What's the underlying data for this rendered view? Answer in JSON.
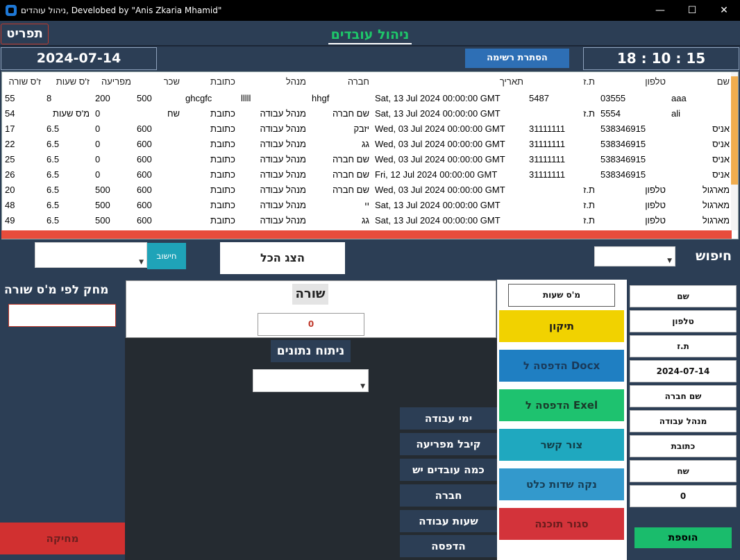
{
  "window": {
    "title": "ניהול עוהדים, Develobed by \"Anis Zkaria Mhamid\"",
    "minimize": "—",
    "maximize": "☐",
    "close": "✕"
  },
  "header": {
    "menu_label": "תפריט",
    "app_title": "ניהול עובדים",
    "date": "2024-07-14",
    "hide_list_label": "הסתרת רשימה",
    "time": "18 : 10 : 15"
  },
  "table": {
    "columns": [
      "ז'ס שורה",
      "ז'ס שעות",
      "מפריעה",
      "שכר",
      "כתובת",
      "מנהל",
      "חברה",
      "תאריך",
      "ת.ז",
      "טלפון",
      "שם"
    ],
    "rows": [
      [
        "55",
        "8",
        "200",
        "500",
        "ghcgfc",
        "lllll",
        "hhgf",
        "Sat, 13 Jul 2024 00:00:00 GMT",
        "5487",
        "03555",
        "aaa"
      ],
      [
        "54",
        "מ'ס שעות",
        "0",
        "שח",
        "כתובת",
        "מנהל עבודה",
        "שם חברה",
        "Sat, 13 Jul 2024 00:00:00 GMT",
        "ת.ז",
        "5554",
        "ali"
      ],
      [
        "17",
        "6.5",
        "0",
        "600",
        "כתובת",
        "מנהל עבודה",
        "יזבק",
        "Wed, 03 Jul 2024 00:00:00 GMT",
        "31111111",
        "538346915",
        "אניס"
      ],
      [
        "22",
        "6.5",
        "0",
        "600",
        "כתובת",
        "מנהל עבודה",
        "גג",
        "Wed, 03 Jul 2024 00:00:00 GMT",
        "31111111",
        "538346915",
        "אניס"
      ],
      [
        "25",
        "6.5",
        "0",
        "600",
        "כתובת",
        "מנהל עבודה",
        "שם חברה",
        "Wed, 03 Jul 2024 00:00:00 GMT",
        "31111111",
        "538346915",
        "אניס"
      ],
      [
        "26",
        "6.5",
        "0",
        "600",
        "כתובת",
        "מנהל עבודה",
        "שם חברה",
        "Fri, 12 Jul 2024 00:00:00 GMT",
        "31111111",
        "538346915",
        "אניס"
      ],
      [
        "20",
        "6.5",
        "500",
        "600",
        "כתובת",
        "מנהל עבודה",
        "שם חברה",
        "Wed, 03 Jul 2024 00:00:00 GMT",
        "ת.ז",
        "טלפון",
        "מארגול"
      ],
      [
        "48",
        "6.5",
        "500",
        "600",
        "כתובת",
        "מנהל עבודה",
        "יי",
        "Sat, 13 Jul 2024 00:00:00 GMT",
        "ת.ז",
        "טלפון",
        "מארגול"
      ],
      [
        "49",
        "6.5",
        "500",
        "600",
        "כתובת",
        "מנהל עבודה",
        "גג",
        "Sat, 13 Jul 2024 00:00:00 GMT",
        "ת.ז",
        "טלפון",
        "מארגול"
      ]
    ]
  },
  "search": {
    "label": "חיפוש",
    "calc_label": "חישוב",
    "show_all_label": "הצג הכל"
  },
  "form": {
    "fields": [
      "שם",
      "טלפון",
      "ת.ז",
      "2024-07-14",
      "שם חברה",
      "מנהל עבודה",
      "כתובת",
      "שח",
      "0"
    ],
    "add_label": "הוספת"
  },
  "actions": {
    "hours_field": "מ'ס שעות",
    "buttons": [
      {
        "label": "תיקון",
        "bg": "#f1d200",
        "fg": "#1a1a1a"
      },
      {
        "label": "הדפסה ל Docx",
        "bg": "#1f7fc2",
        "fg": "#1a3a5a"
      },
      {
        "label": "הדפסה ל Exel",
        "bg": "#1ec26f",
        "fg": "#1a3a2a"
      },
      {
        "label": "צור קשר",
        "bg": "#1fa8bf",
        "fg": "#12404a"
      },
      {
        "label": "נקה שדות כלט",
        "bg": "#3399cc",
        "fg": "#173e55"
      },
      {
        "label": "סגור תוכנה",
        "bg": "#d3333a",
        "fg": "#6a1c1c"
      }
    ]
  },
  "row_panel": {
    "title": "שורה",
    "value": "0"
  },
  "analysis": {
    "title": "ניתוח נתונים",
    "queries": [
      "ימי עבודה",
      "קיבל מפריעה",
      "כמה עובדים יש",
      "חברה",
      "שעות עבודה",
      "הדפסה"
    ]
  },
  "delete": {
    "label": "מחק לפי מ'ס שורה",
    "button_label": "מחיקה"
  },
  "colors": {
    "background": "#2c3e55",
    "title_green": "#1ec76a",
    "scroll_thumb": "#f0ad4e",
    "hscroll": "#e74c3c"
  }
}
